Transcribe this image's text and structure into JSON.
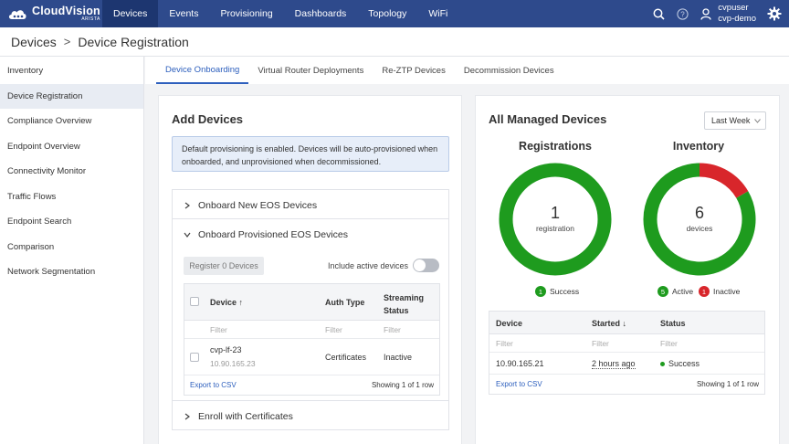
{
  "nav": {
    "logo_main": "CloudVision",
    "logo_sub": "ARISTA",
    "items": [
      {
        "label": "Devices"
      },
      {
        "label": "Events"
      },
      {
        "label": "Provisioning"
      },
      {
        "label": "Dashboards"
      },
      {
        "label": "Topology"
      },
      {
        "label": "WiFi"
      }
    ],
    "active_index": 0,
    "user_name": "cvpuser",
    "user_org": "cvp-demo",
    "help_glyph": "?",
    "brand_color": "#2e4a8c",
    "icons": [
      "search-icon",
      "help-icon",
      "user-icon",
      "gear-icon"
    ]
  },
  "breadcrumb": {
    "parent": "Devices",
    "separator": ">",
    "current": "Device Registration"
  },
  "sidebar": {
    "items": [
      {
        "label": "Inventory"
      },
      {
        "label": "Device Registration"
      },
      {
        "label": "Compliance Overview"
      },
      {
        "label": "Endpoint Overview"
      },
      {
        "label": "Connectivity Monitor"
      },
      {
        "label": "Traffic Flows"
      },
      {
        "label": "Endpoint Search"
      },
      {
        "label": "Comparison"
      },
      {
        "label": "Network Segmentation"
      }
    ],
    "active_index": 1
  },
  "tabs": {
    "items": [
      {
        "label": "Device Onboarding"
      },
      {
        "label": "Virtual Router Deployments"
      },
      {
        "label": "Re-ZTP Devices"
      },
      {
        "label": "Decommission Devices"
      }
    ],
    "active_index": 0
  },
  "add_devices": {
    "title": "Add Devices",
    "info": "Default provisioning is enabled. Devices will be auto-provisioned when onboarded, and unprovisioned when decommissioned.",
    "sections": [
      {
        "label": "Onboard New EOS Devices",
        "expanded": false
      },
      {
        "label": "Onboard Provisioned EOS Devices",
        "expanded": true
      },
      {
        "label": "Enroll with Certificates",
        "expanded": false
      }
    ],
    "register_button": "Register 0 Devices",
    "include_active_label": "Include active devices",
    "include_active_on": false,
    "table": {
      "columns": [
        "Device",
        "Auth Type",
        "Streaming Status"
      ],
      "sort_glyph": "↑",
      "filter_placeholder": "Filter",
      "rows": [
        {
          "device": "cvp-lf-23",
          "ip": "10.90.165.23",
          "auth": "Certificates",
          "status": "Inactive"
        }
      ],
      "export_label": "Export to CSV",
      "showing": "Showing 1 of 1 row"
    }
  },
  "managed": {
    "title": "All Managed Devices",
    "range": "Last Week",
    "registrations": {
      "title": "Registrations",
      "count": "1",
      "unit": "registration",
      "segments": [
        {
          "label": "Success",
          "value": 1,
          "color": "#1e9b1e"
        }
      ]
    },
    "inventory": {
      "title": "Inventory",
      "count": "6",
      "unit": "devices",
      "segments": [
        {
          "label": "Active",
          "value": 5,
          "color": "#1e9b1e"
        },
        {
          "label": "Inactive",
          "value": 1,
          "color": "#d8262b"
        }
      ]
    },
    "table": {
      "columns": [
        "Device",
        "Started",
        "Status"
      ],
      "sort_glyph": "↓",
      "filter_placeholder": "Filter",
      "rows": [
        {
          "device": "10.90.165.21",
          "started": "2 hours ago",
          "status": "Success"
        }
      ],
      "export_label": "Export to CSV",
      "showing": "Showing 1 of 1 row"
    }
  }
}
